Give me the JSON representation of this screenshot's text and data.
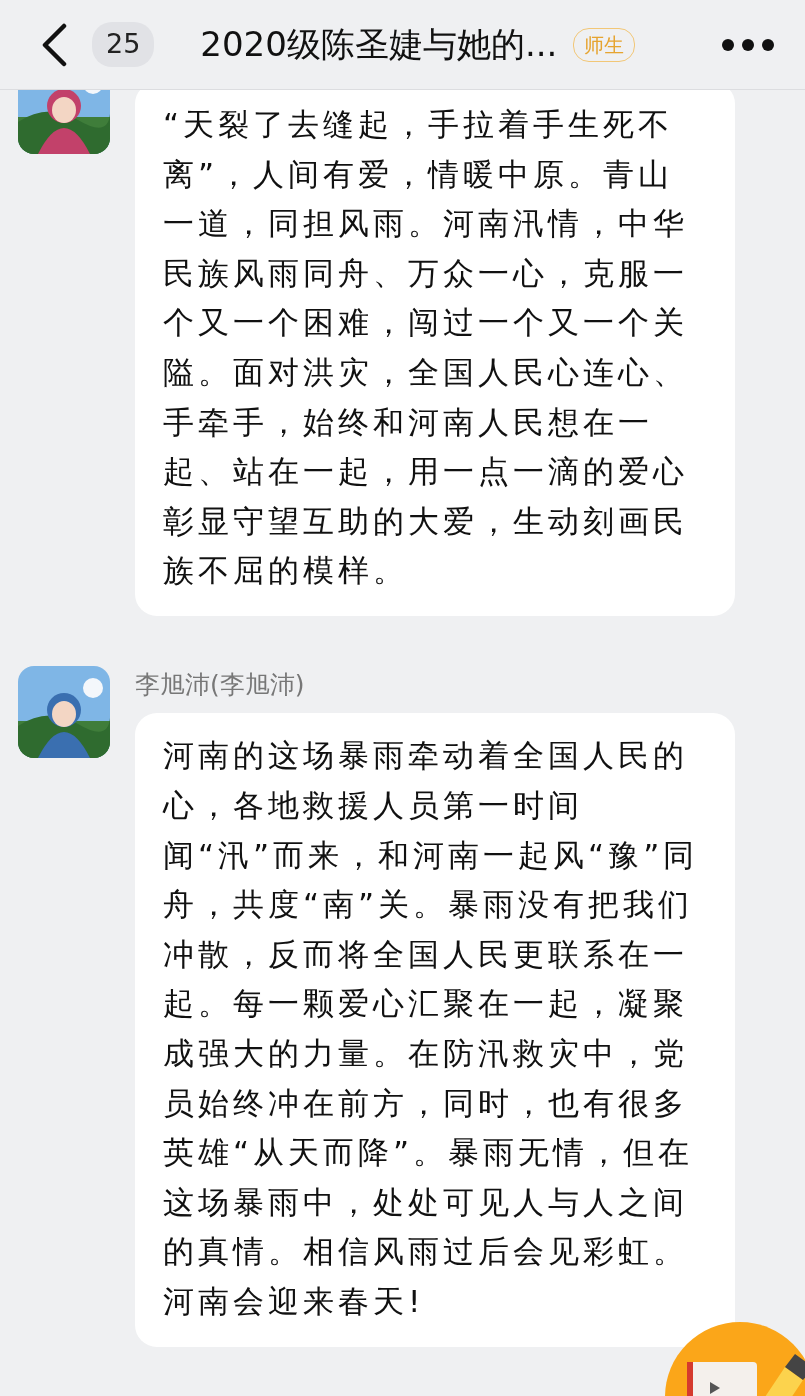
{
  "header": {
    "unread_count": "25",
    "title": "2020级陈圣婕与她的...",
    "tag": "师生"
  },
  "messages": [
    {
      "text": "“天裂了去缝起，手拉着手生死不离”，人间有爱，情暖中原。青山一道，同担风雨。河南汛情，中华民族风雨同舟、万众一心，克服一个又一个困难，闯过一个又一个关隘。面对洪灾，全国人民心连心、手牵手，始终和河南人民想在一起、站在一起，用一点一滴的爱心彰显守望互助的大爱，生动刻画民族不屈的模样。"
    },
    {
      "sender": "李旭沛(李旭沛)",
      "text": "河南的这场暴雨牵动着全国人民的心，各地救援人员第一时间闻“汛”而来，和河南一起风“豫”同舟，共度“南”关。暴雨没有把我们冲散，反而将全国人民更联系在一起。每一颗爱心汇聚在一起，凝聚成强大的力量。在防汛救灾中，党员始终冲在前方，同时，也有很多英雄“从天而降”。暴雨无情，但在这场暴雨中，处处可见人与人之间的真情。相信风雨过后会见彩虹。河南会迎来春天!"
    }
  ]
}
